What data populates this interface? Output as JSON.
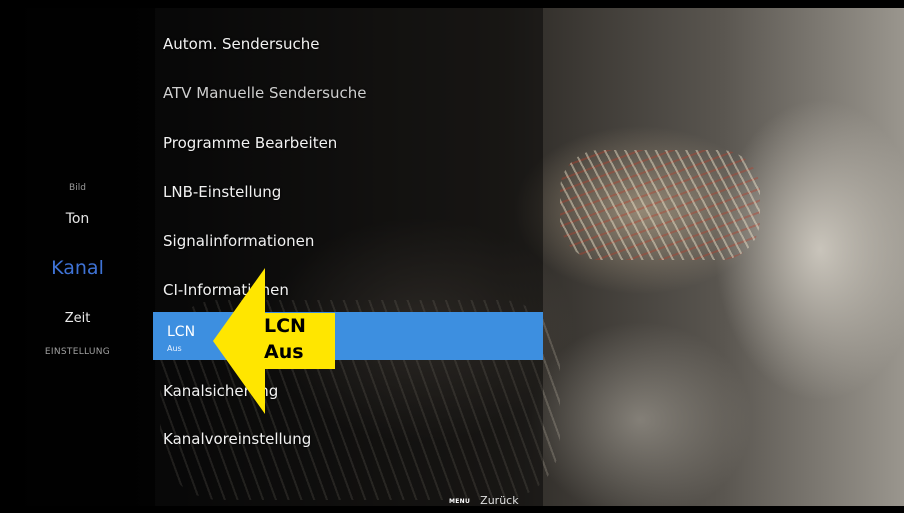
{
  "sidebar": {
    "items": [
      {
        "label": "Bild"
      },
      {
        "label": "Ton"
      },
      {
        "label": "Kanal"
      },
      {
        "label": "Zeit"
      },
      {
        "label": "EINSTELLUNG"
      }
    ],
    "active": "Kanal",
    "active_color": "#3f73d6"
  },
  "menu": {
    "items": [
      {
        "label": "Autom. Sendersuche"
      },
      {
        "label": "ATV Manuelle Sendersuche"
      },
      {
        "label": "Programme Bearbeiten"
      },
      {
        "label": "LNB-Einstellung"
      },
      {
        "label": "Signalinformationen"
      },
      {
        "label": "CI-Informationen"
      },
      {
        "label": "LCN",
        "value": "Aus"
      },
      {
        "label": "Kanalsicherung"
      },
      {
        "label": "Kanalvoreinstellung"
      }
    ],
    "selected": "LCN",
    "highlight_color": "#3d8fe0"
  },
  "annotation": {
    "line1": "LCN",
    "line2": "Aus",
    "arrow_color": "#ffe600",
    "arrow_icon": "arrow-left-icon"
  },
  "footer": {
    "key": "MENU",
    "label": "Zurück"
  }
}
